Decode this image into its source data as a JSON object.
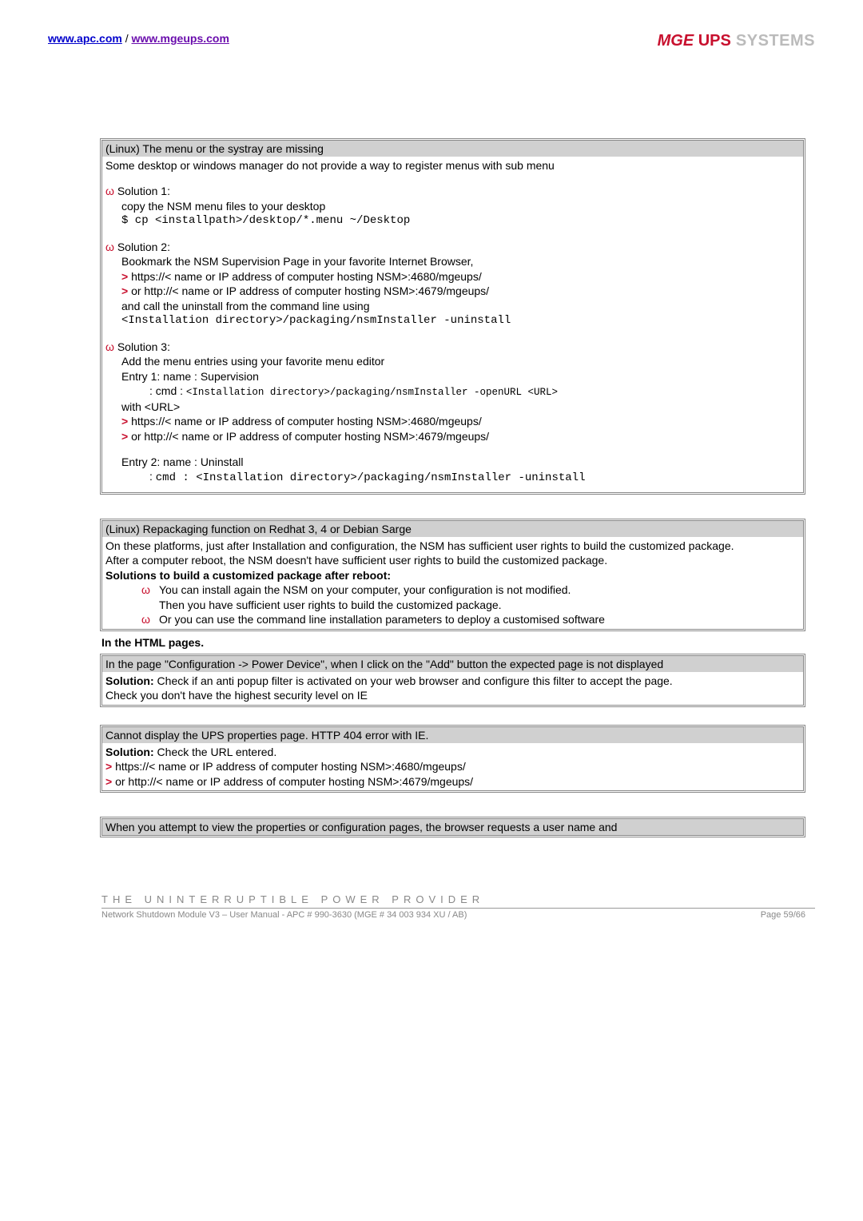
{
  "header": {
    "link1_text": "www.apc.com",
    "sep": " / ",
    "link2_text": "www.mgeups.com",
    "logo_mge": "MGE",
    "logo_ups": " UPS",
    "logo_systems": " SYSTEMS"
  },
  "box1": {
    "title": "(Linux) The menu or the systray are missing",
    "intro": " Some desktop or windows manager do not provide a way to register menus with sub menu",
    "sol1_label": " Solution 1:",
    "sol1_l1": "copy the NSM menu files to your desktop",
    "sol1_l2": "$ cp <installpath>/desktop/*.menu ~/Desktop",
    "sol2_label": " Solution 2:",
    "sol2_l1": "Bookmark the NSM Supervision Page in your favorite Internet Browser,",
    "sol2_l2a": " https://< name or IP address of computer hosting NSM>:4680/mgeups/",
    "sol2_l3a": " or http://< name or IP address of computer hosting NSM>:4679/mgeups/",
    "sol2_l4": "and call the uninstall from the command line using",
    "sol2_l5": "<Installation directory>/packaging/nsmInstaller -uninstall",
    "sol3_label": " Solution 3:",
    "sol3_l1": "Add the menu entries using your favorite menu editor",
    "sol3_l2": "Entry 1: name : Supervision",
    "sol3_l3a": " : cmd : ",
    "sol3_l3b": "<Installation directory>/packaging/nsmInstaller -openURL <URL>",
    "sol3_l4": "with <URL>",
    "sol3_l5a": " https://< name or IP address of computer hosting NSM>:4680/mgeups/",
    "sol3_l6a": " or http://< name or IP address of computer hosting NSM>:4679/mgeups/",
    "sol3_l7": "Entry 2: name : Uninstall",
    "sol3_l8a": " : ",
    "sol3_l8b": "cmd : <Installation directory>/packaging/nsmInstaller -uninstall"
  },
  "box2": {
    "title": "(Linux) Repackaging function on Redhat 3, 4 or Debian Sarge",
    "p1": " On these platforms, just after Installation and configuration, the NSM has sufficient user rights to build the customized package.",
    "p2": "After a computer reboot, the NSM doesn't have sufficient user rights to build the customized package.",
    "p3": "Solutions to build a customized package after reboot:",
    "li1": "You can install again the NSM on your computer, your configuration is not modified.",
    "li1b": "Then you have sufficient user rights to build the customized package.",
    "li2": "Or you can use the command line installation parameters to deploy a customised software"
  },
  "section_html": "In the HTML pages.",
  "box3": {
    "title": "In the page \"Configuration -> Power Device\", when I click on the \"Add\" button the expected page is not displayed",
    "sol_label": "Solution:",
    "sol_text": " Check if an anti popup filter is activated on your web browser and configure this filter to accept the page.",
    "l2": "Check you don't have the highest security level on IE"
  },
  "box4": {
    "title": "  Cannot display the UPS properties page. HTTP 404 error with IE.",
    "sol_label": "Solution:",
    "sol_text": " Check the URL entered.",
    "l2": " https://< name or IP address of computer hosting NSM>:4680/mgeups/",
    "l3": " or http://< name or IP address of computer hosting NSM>:4679/mgeups/"
  },
  "box5": {
    "title": " When you attempt to view the properties or configuration pages, the browser requests a user name and"
  },
  "footer": {
    "tagline": "THE UNINTERRUPTIBLE POWER PROVIDER",
    "left": "Network Shutdown Module V3 – User Manual - APC # 990-3630 (MGE # 34 003 934 XU / AB)",
    "right": "Page 59/66"
  }
}
